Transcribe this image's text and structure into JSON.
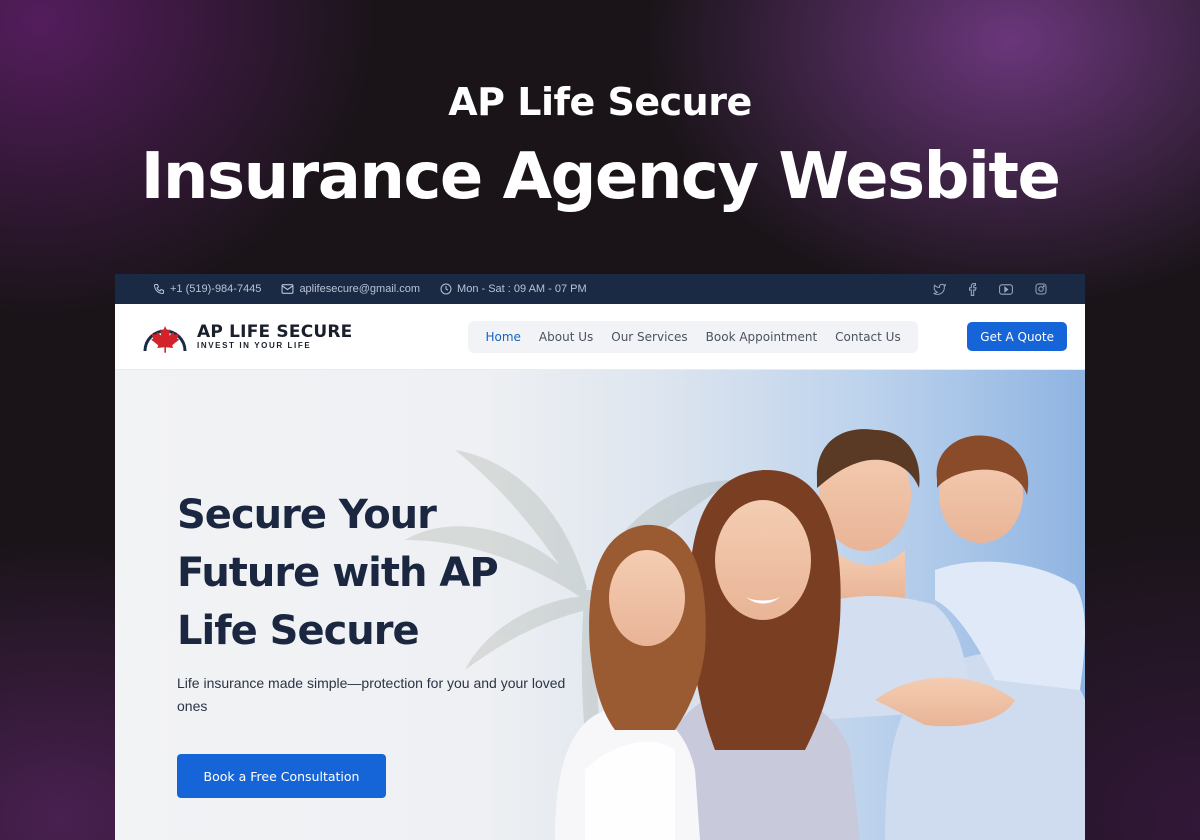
{
  "promo": {
    "title": "AP Life Secure",
    "heading": "Insurance Agency Wesbite"
  },
  "topbar": {
    "phone": "+1 (519)-984-7445",
    "email": "aplifesecure@gmail.com",
    "hours": "Mon - Sat : 09 AM - 07 PM",
    "socials": [
      "twitter-icon",
      "facebook-icon",
      "youtube-icon",
      "instagram-icon"
    ]
  },
  "logo": {
    "name": "AP LIFE SECURE",
    "tagline": "INVEST IN YOUR LIFE"
  },
  "nav": {
    "items": [
      {
        "label": "Home",
        "active": true
      },
      {
        "label": "About Us",
        "active": false
      },
      {
        "label": "Our Services",
        "active": false
      },
      {
        "label": "Book Appointment",
        "active": false
      },
      {
        "label": "Contact Us",
        "active": false
      }
    ],
    "cta": "Get A Quote"
  },
  "hero": {
    "title": "Secure Your Future with AP Life Secure",
    "subtitle": "Life insurance made simple—protection for you and your loved ones",
    "button": "Book a Free Consultation"
  },
  "colors": {
    "accent": "#1565d8",
    "topbar": "#1b2a44",
    "heading": "#1b2740",
    "maple": "#d2232a"
  }
}
